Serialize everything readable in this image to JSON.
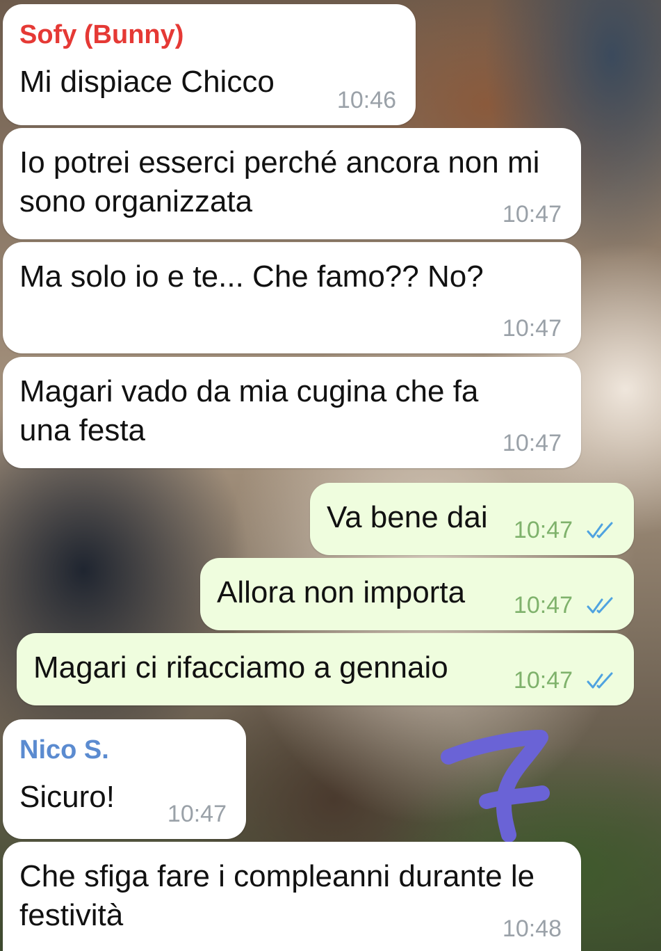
{
  "chat": {
    "messages": [
      {
        "sender": "Sofy (Bunny)",
        "text": "Mi dispiace Chicco",
        "time": "10:46"
      },
      {
        "text": "Io potrei esserci perché ancora non mi sono organizzata",
        "time": "10:47"
      },
      {
        "text": "Ma solo io e te... Che famo?? No?",
        "time": "10:47"
      },
      {
        "text": "Magari vado da mia cugina che fa una festa",
        "time": "10:47"
      },
      {
        "text": "Va bene dai",
        "time": "10:47",
        "outgoing": true,
        "status": "read"
      },
      {
        "text": "Allora non importa",
        "time": "10:47",
        "outgoing": true,
        "status": "read"
      },
      {
        "text": "Magari ci rifacciamo a gennaio",
        "time": "10:47",
        "outgoing": true,
        "status": "read"
      },
      {
        "sender": "Nico S.",
        "text": "Sicuro!",
        "time": "10:47"
      },
      {
        "text": "Che sfiga fare i compleanni durante le festività",
        "time": "10:48"
      }
    ]
  },
  "colors": {
    "sender_sofy": "#e53935",
    "sender_nico": "#5b8bd0",
    "incoming_bubble": "#ffffff",
    "outgoing_bubble": "#effdde",
    "read_ticks": "#4fa3e0",
    "annotation_stroke": "#6a63d6"
  },
  "icons": {
    "read_receipt": "double-check-icon"
  }
}
